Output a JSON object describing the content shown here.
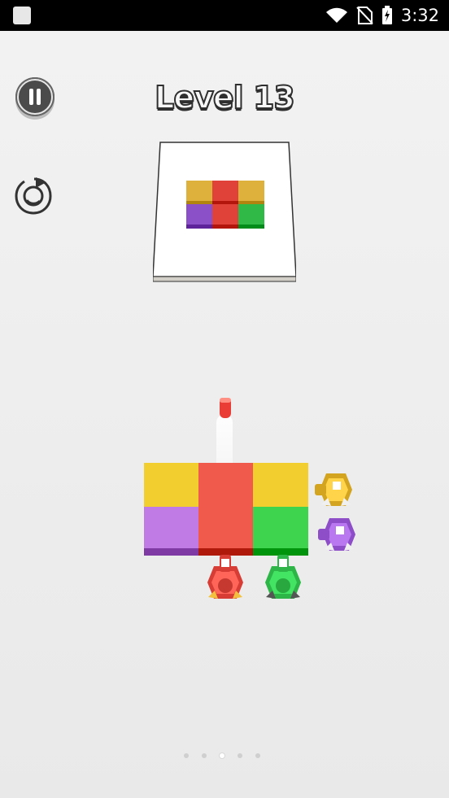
{
  "status_bar": {
    "time": "3:32",
    "icons": [
      "app-notification-icon",
      "wifi-icon",
      "no-sim-icon",
      "battery-charging-icon"
    ]
  },
  "game": {
    "level_title": "Level 13",
    "buttons": [
      "pause-icon",
      "restart-icon"
    ],
    "target_pattern": {
      "rows": [
        [
          "yellow",
          "red",
          "yellow"
        ],
        [
          "purple",
          "red",
          "green"
        ]
      ]
    },
    "board": {
      "rows": [
        [
          "yellow",
          "red",
          "yellow"
        ],
        [
          "purple",
          "red",
          "green"
        ]
      ]
    },
    "shooters": {
      "bottom": [
        "red",
        "green"
      ],
      "side": [
        "yellow",
        "purple"
      ]
    },
    "projectile": "red",
    "colors": {
      "yellow": "#f2ce2e",
      "red": "#f05a4c",
      "purple": "#c17be4",
      "green": "#3fd44d",
      "preview_yellow": "#ddb13b",
      "preview_red": "#e04239",
      "preview_purple": "#8b50c7",
      "preview_green": "#31b947"
    },
    "page_indicator": {
      "total": 5,
      "current": 3
    }
  }
}
